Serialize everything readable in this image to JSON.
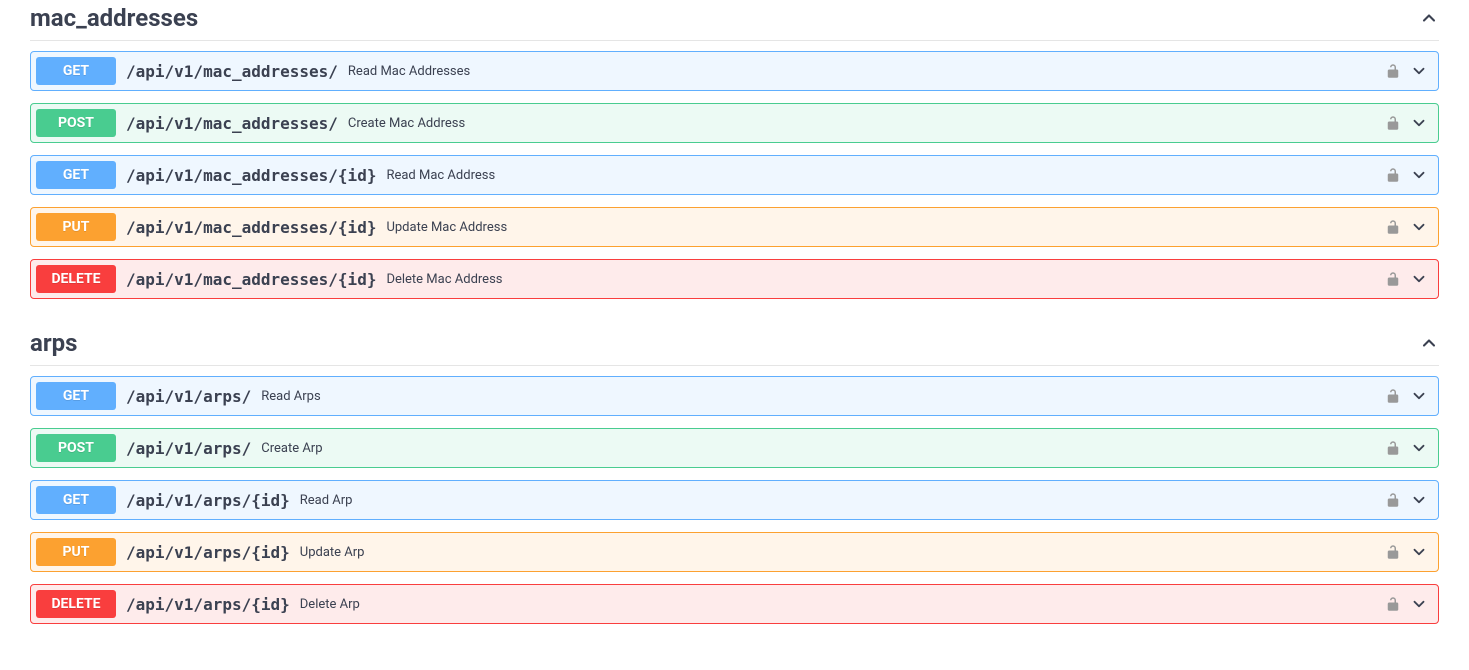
{
  "tags": [
    {
      "name": "mac_addresses",
      "ops": [
        {
          "method": "GET",
          "css": "get",
          "path": "/api/v1/mac_addresses/",
          "summary": "Read Mac Addresses"
        },
        {
          "method": "POST",
          "css": "post",
          "path": "/api/v1/mac_addresses/",
          "summary": "Create Mac Address"
        },
        {
          "method": "GET",
          "css": "get",
          "path": "/api/v1/mac_addresses/{id}",
          "summary": "Read Mac Address"
        },
        {
          "method": "PUT",
          "css": "put",
          "path": "/api/v1/mac_addresses/{id}",
          "summary": "Update Mac Address"
        },
        {
          "method": "DELETE",
          "css": "delete",
          "path": "/api/v1/mac_addresses/{id}",
          "summary": "Delete Mac Address"
        }
      ]
    },
    {
      "name": "arps",
      "ops": [
        {
          "method": "GET",
          "css": "get",
          "path": "/api/v1/arps/",
          "summary": "Read Arps"
        },
        {
          "method": "POST",
          "css": "post",
          "path": "/api/v1/arps/",
          "summary": "Create Arp"
        },
        {
          "method": "GET",
          "css": "get",
          "path": "/api/v1/arps/{id}",
          "summary": "Read Arp"
        },
        {
          "method": "PUT",
          "css": "put",
          "path": "/api/v1/arps/{id}",
          "summary": "Update Arp"
        },
        {
          "method": "DELETE",
          "css": "delete",
          "path": "/api/v1/arps/{id}",
          "summary": "Delete Arp"
        }
      ]
    }
  ]
}
